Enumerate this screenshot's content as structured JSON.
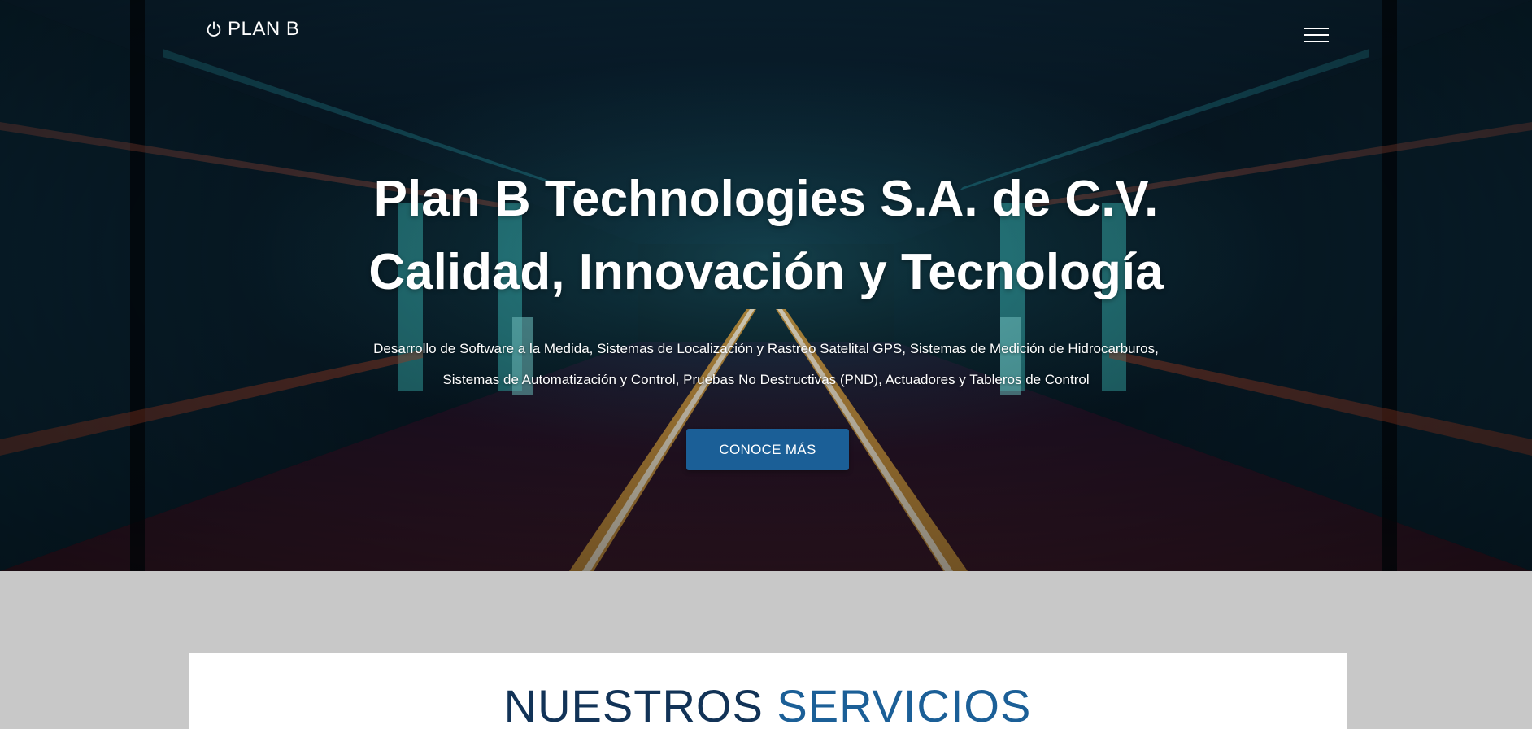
{
  "brand": {
    "name": "PLAN B",
    "icon": "power-icon"
  },
  "nav": {
    "menu_icon": "hamburger-menu-icon"
  },
  "hero": {
    "title_line1": "Plan B Technologies S.A. de C.V.",
    "title_line2": "Calidad, Innovación y Tecnología",
    "subtitle_line1": "Desarrollo de Software a la Medida, Sistemas de Localización y Rastreo Satelital GPS, Sistemas de Medición de Hidrocarburos,",
    "subtitle_line2": "Sistemas de Automatización y Control, Pruebas No Destructivas (PND), Actuadores y Tableros de Control",
    "cta_label": "CONOCE MÁS"
  },
  "services": {
    "heading_part1": "NUESTROS",
    "heading_part2": "SERVICIOS"
  },
  "colors": {
    "primary": "#1b5f97",
    "heading_dark": "#123357",
    "section_bg": "#c8c8c8",
    "hero_bg": "#071420"
  }
}
